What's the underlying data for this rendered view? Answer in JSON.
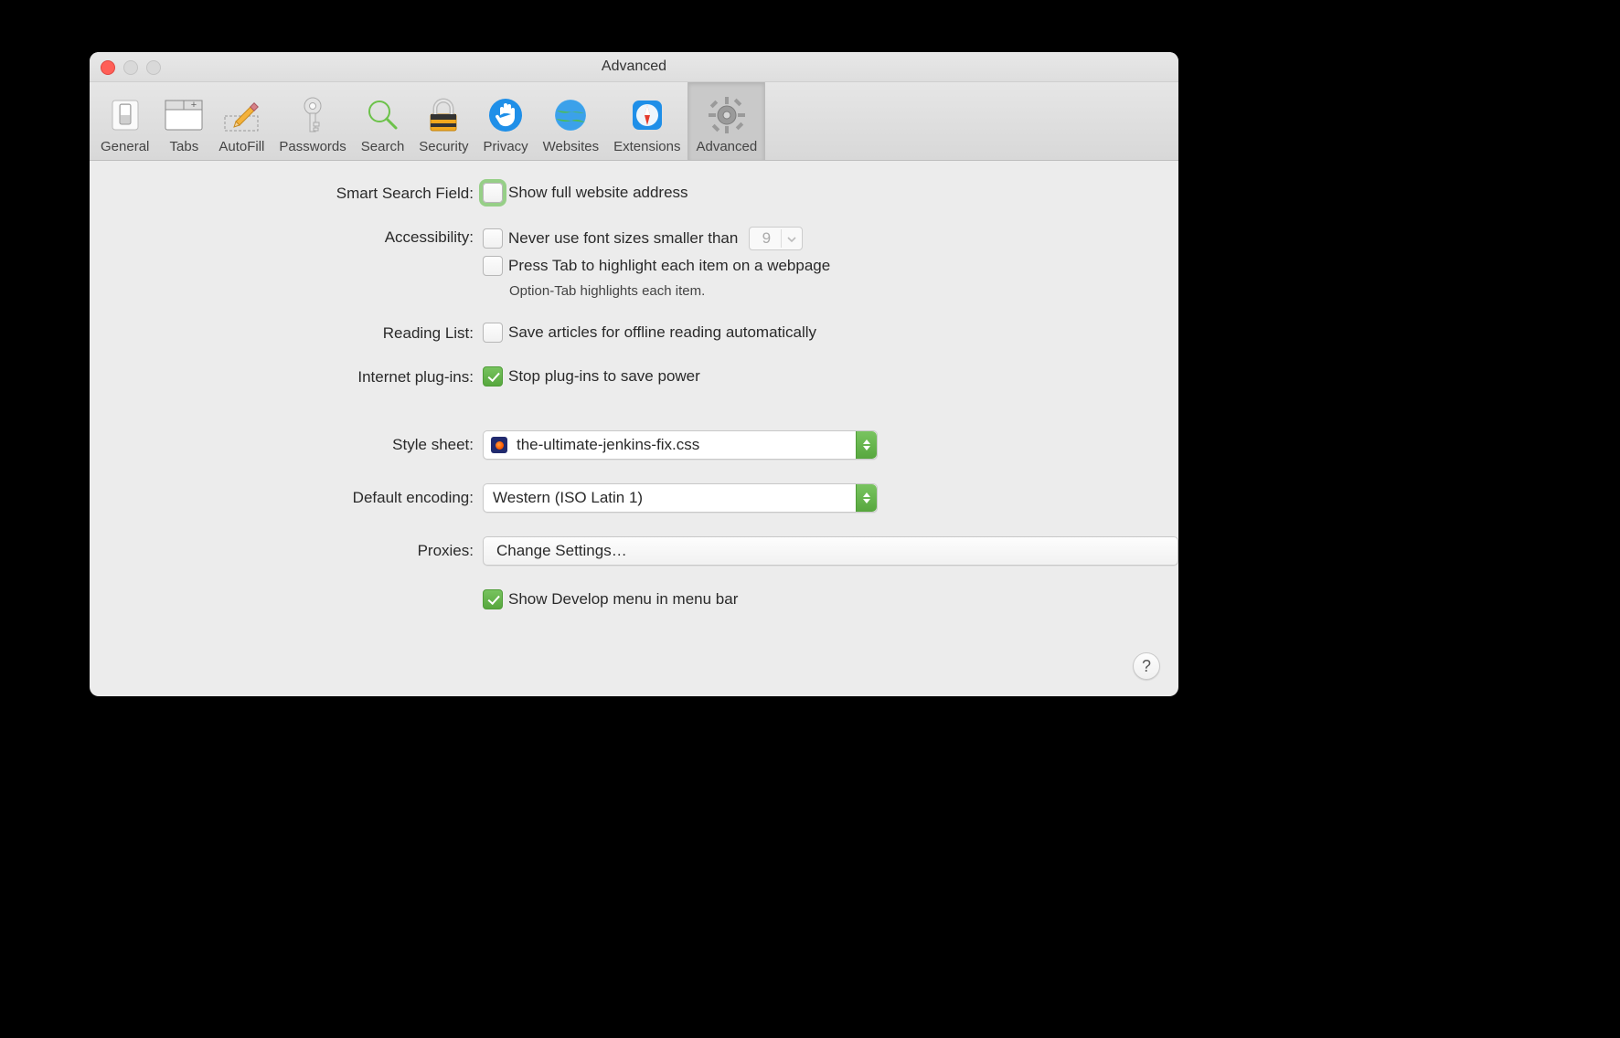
{
  "window": {
    "title": "Advanced"
  },
  "toolbar": {
    "items": [
      {
        "label": "General"
      },
      {
        "label": "Tabs"
      },
      {
        "label": "AutoFill"
      },
      {
        "label": "Passwords"
      },
      {
        "label": "Search"
      },
      {
        "label": "Security"
      },
      {
        "label": "Privacy"
      },
      {
        "label": "Websites"
      },
      {
        "label": "Extensions"
      },
      {
        "label": "Advanced"
      }
    ]
  },
  "labels": {
    "smart_search": "Smart Search Field:",
    "accessibility": "Accessibility:",
    "reading_list": "Reading List:",
    "plugins": "Internet plug-ins:",
    "stylesheet": "Style sheet:",
    "encoding": "Default encoding:",
    "proxies": "Proxies:"
  },
  "options": {
    "show_full_address": "Show full website address",
    "never_font_smaller": "Never use font sizes smaller than",
    "font_size_value": "9",
    "press_tab": "Press Tab to highlight each item on a webpage",
    "option_tab_hint": "Option-Tab highlights each item.",
    "save_offline": "Save articles for offline reading automatically",
    "stop_plugins": "Stop plug-ins to save power",
    "stylesheet_value": "the-ultimate-jenkins-fix.css",
    "encoding_value": "Western (ISO Latin 1)",
    "change_settings": "Change Settings…",
    "show_develop": "Show Develop menu in menu bar"
  },
  "help": {
    "label": "?"
  }
}
